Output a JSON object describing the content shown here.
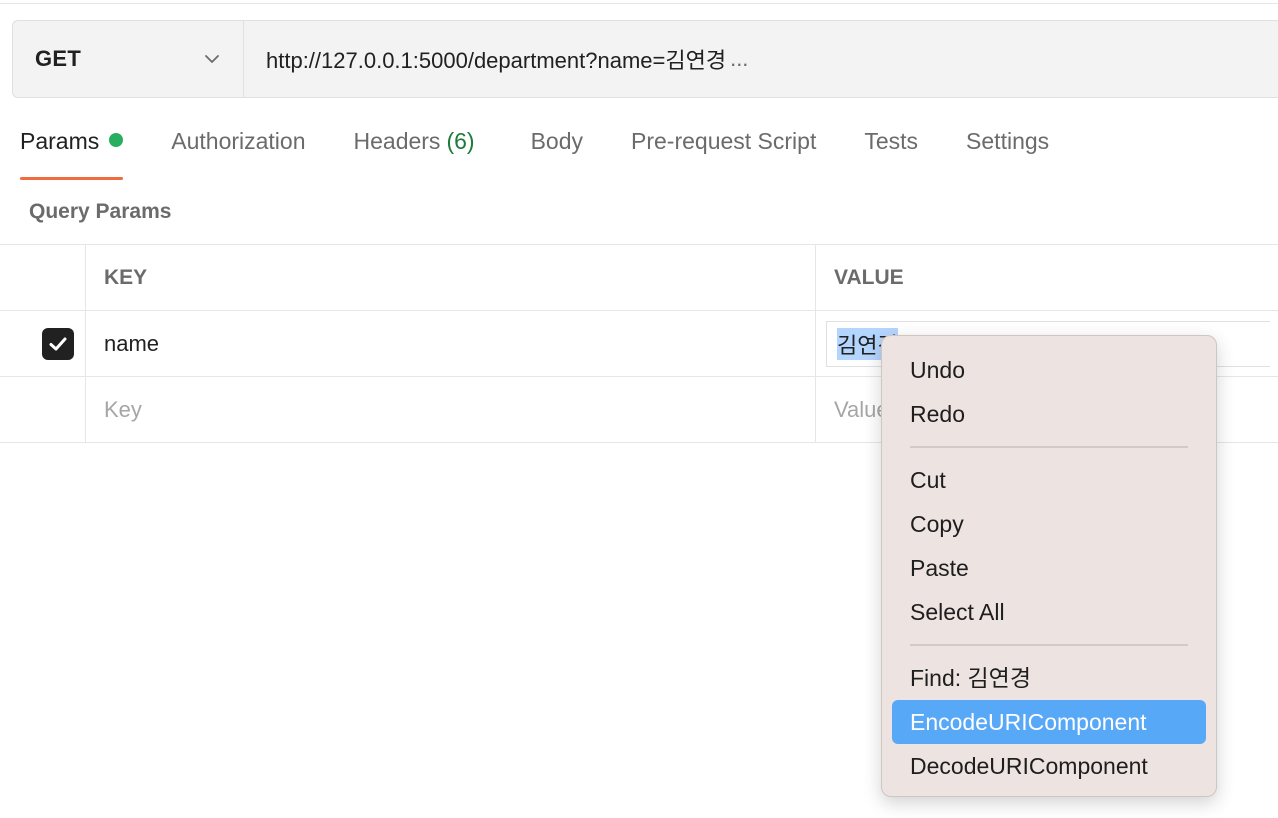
{
  "request": {
    "method": "GET",
    "url": "http://127.0.0.1:5000/department?name=김연경",
    "url_ellipsis": "..."
  },
  "tabs": [
    {
      "label": "Params",
      "active": true,
      "indicator": "green-dot"
    },
    {
      "label": "Authorization"
    },
    {
      "label": "Headers",
      "count": "(6)"
    },
    {
      "label": "Body"
    },
    {
      "label": "Pre-request Script"
    },
    {
      "label": "Tests"
    },
    {
      "label": "Settings"
    }
  ],
  "query_params": {
    "title": "Query Params",
    "columns": {
      "key": "KEY",
      "value": "VALUE"
    },
    "rows": [
      {
        "checked": true,
        "key": "name",
        "value": "김연경",
        "selected_part": "김연경"
      }
    ],
    "new_row": {
      "key_placeholder": "Key",
      "value_placeholder": "Value"
    }
  },
  "context_menu": {
    "groups": [
      [
        {
          "label": "Undo"
        },
        {
          "label": "Redo"
        }
      ],
      [
        {
          "label": "Cut"
        },
        {
          "label": "Copy"
        },
        {
          "label": "Paste"
        },
        {
          "label": "Select All"
        }
      ],
      [
        {
          "label": "Find: 김연경"
        },
        {
          "label": "EncodeURIComponent",
          "highlighted": true
        },
        {
          "label": "DecodeURIComponent"
        }
      ]
    ]
  },
  "colors": {
    "accent_tab_underline": "#ef6c40",
    "status_dot": "#27ae60",
    "headers_count": "#1e7b3a",
    "menu_highlight": "#58a8f8",
    "text_selection": "#b4d5fe"
  }
}
